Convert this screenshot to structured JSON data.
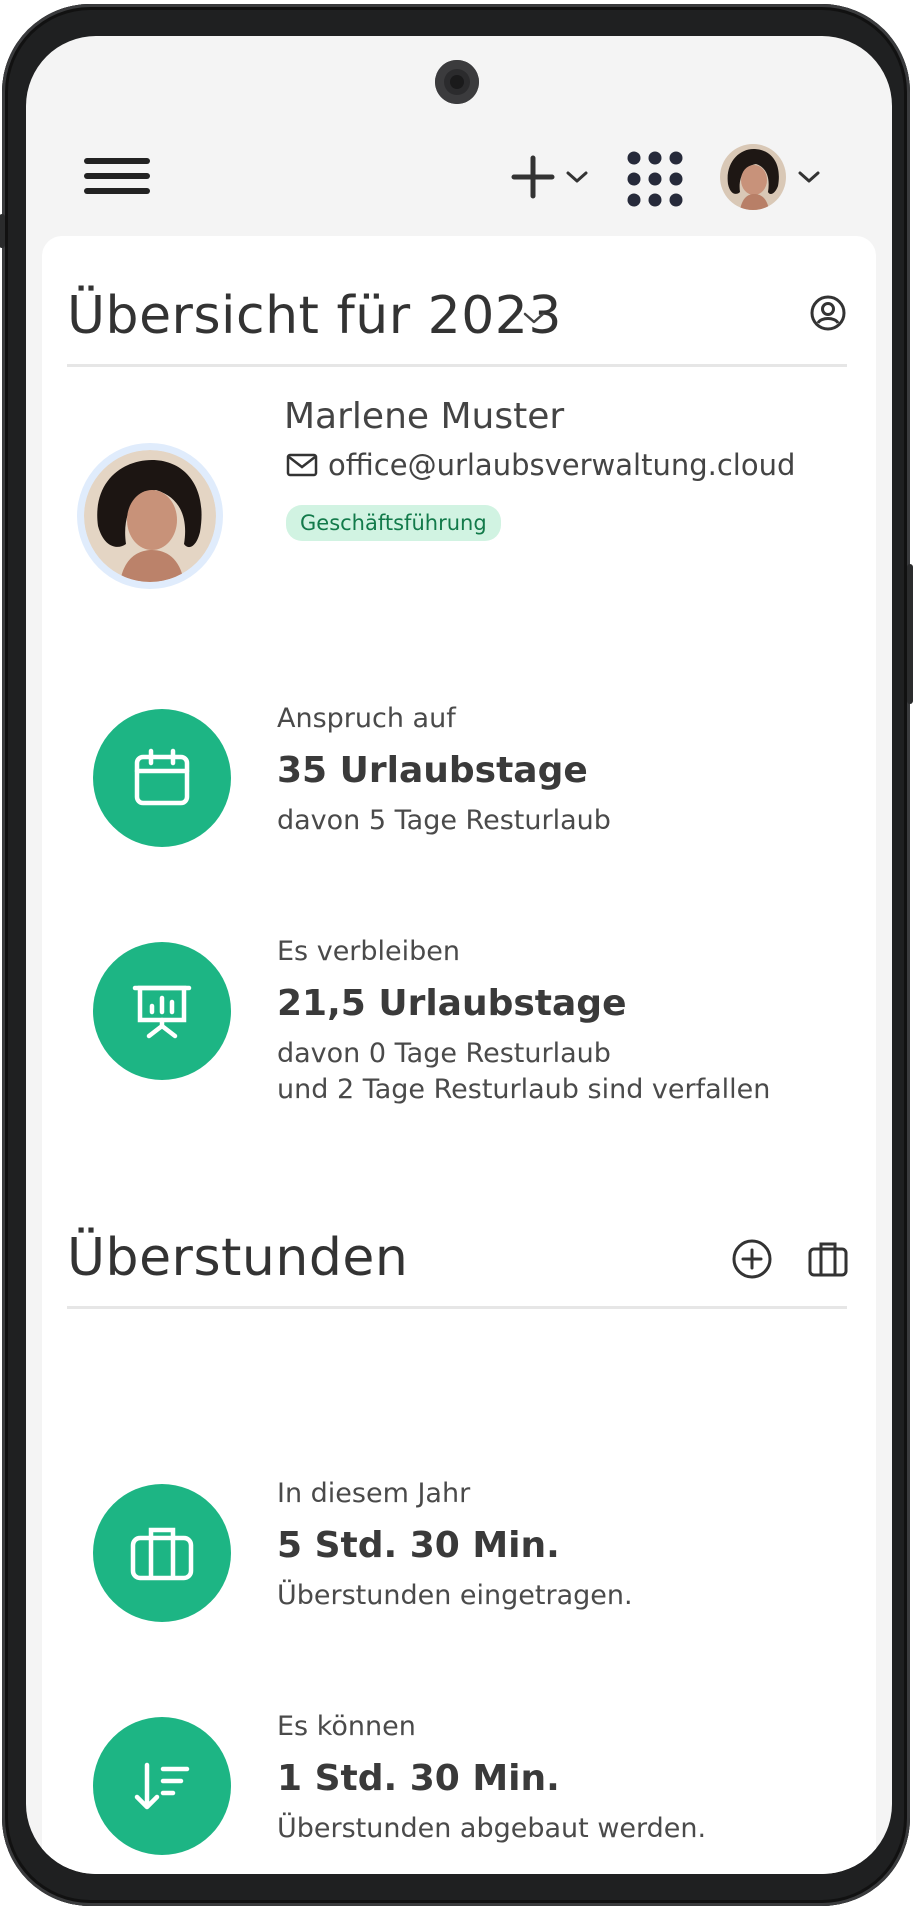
{
  "topbar": {
    "menu_icon": "hamburger-menu-icon",
    "add_icon": "plus-icon",
    "apps_icon": "grid-apps-icon",
    "chevron_icon": "chevron-down-icon"
  },
  "overview": {
    "title": "Übersicht für 2023",
    "profile_icon": "user-circle-icon"
  },
  "person": {
    "name": "Marlene Muster",
    "email": "office@urlaubsverwaltung.cloud",
    "role": "Geschäftsführung"
  },
  "vacation_stats": [
    {
      "icon": "calendar-icon",
      "label": "Anspruch auf",
      "value": "35 Urlaubstage",
      "detail": "davon 5 Tage Resturlaub"
    },
    {
      "icon": "presentation-chart-icon",
      "label": "Es verbleiben",
      "value": "21,5 Urlaubstage",
      "detail": "davon 0 Tage Resturlaub",
      "detail2": "und 2 Tage Resturlaub sind verfallen"
    }
  ],
  "overtime": {
    "title": "Überstunden",
    "add_icon": "plus-circle-icon",
    "briefcase_icon": "briefcase-icon",
    "stats": [
      {
        "icon": "briefcase-icon",
        "label": "In diesem Jahr",
        "value": "5 Std. 30 Min.",
        "detail": "Überstunden eingetragen."
      },
      {
        "icon": "sort-descending-icon",
        "label": "Es können",
        "value": "1 Std. 30 Min.",
        "detail": "Überstunden abgebaut werden."
      }
    ]
  },
  "colors": {
    "accent": "#1db584",
    "badge_bg": "#d1f3e2",
    "badge_text": "#127a4a"
  }
}
